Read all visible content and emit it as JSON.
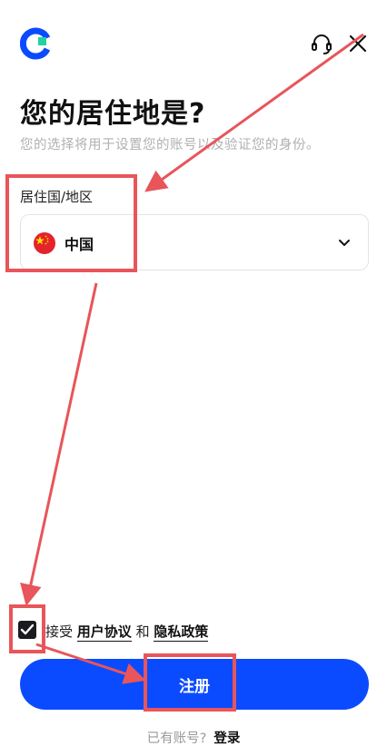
{
  "header": {
    "logo_icon": "brand-logo-icon",
    "support_icon": "headset-icon",
    "close_icon": "close-icon"
  },
  "page": {
    "title": "您的居住地是?",
    "subtitle": "您的选择将用于设置您的账号以及验证您的身份。"
  },
  "residence": {
    "label": "居住国/地区",
    "selected_value": "中国",
    "flag_icon": "china-flag-icon",
    "dropdown_icon": "chevron-down-icon"
  },
  "terms": {
    "checked": true,
    "prefix": "接受",
    "user_agreement": "用户协议",
    "conjunction": "和",
    "privacy_policy": "隐私政策"
  },
  "actions": {
    "register_label": "注册",
    "login_prompt": "已有账号?",
    "login_label": "登录"
  },
  "colors": {
    "primary": "#0b4bff",
    "annotation_red": "#e8555a",
    "flag_red": "#e3242b",
    "flag_star": "#ffde00"
  }
}
